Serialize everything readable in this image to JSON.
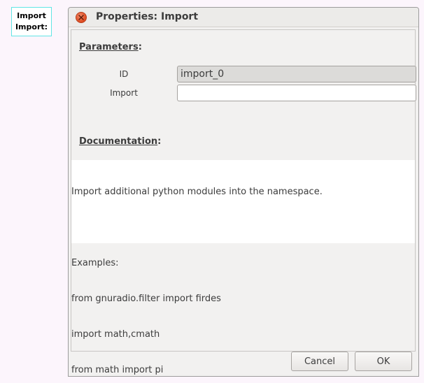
{
  "canvas_block": {
    "line1": "Import",
    "line2": "Import:"
  },
  "dialog": {
    "title": "Properties: Import",
    "close_icon": "close-x-icon",
    "parameters_header": "Parameters",
    "parameters_colon": ":",
    "fields": {
      "id": {
        "label": "ID",
        "value": "import_0"
      },
      "import": {
        "label": "Import",
        "value": "",
        "placeholder": ""
      }
    },
    "documentation_header": "Documentation",
    "documentation_colon": ":",
    "documentation_lines": [
      "Import additional python modules into the namespace.",
      "",
      "Examples:",
      "from gnuradio.filter import firdes",
      "import math,cmath",
      "from math import pi"
    ],
    "buttons": {
      "cancel": "Cancel",
      "ok": "OK"
    }
  },
  "colors": {
    "background": "#fcf5fc",
    "block_border": "#61e5e5",
    "close_button": "#df4a1f"
  }
}
